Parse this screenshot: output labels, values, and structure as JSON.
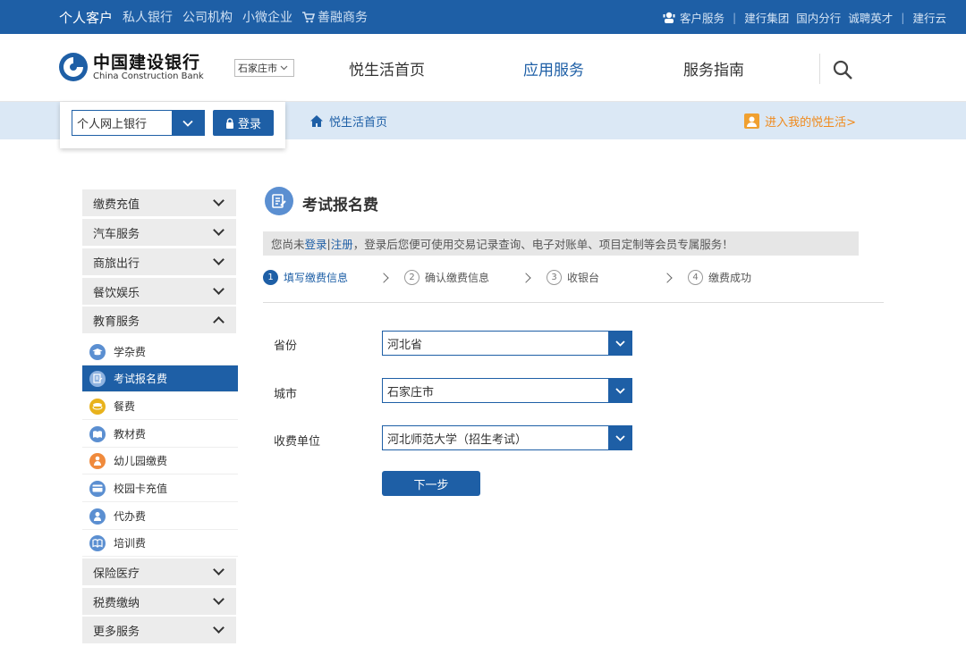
{
  "topbar": {
    "left": [
      {
        "label": "个人客户",
        "active": true
      },
      {
        "label": "私人银行"
      },
      {
        "label": "公司机构"
      },
      {
        "label": "小微企业"
      },
      {
        "label": "善融商务"
      }
    ],
    "customer_service": "客户服务",
    "ccb_group": "建行集团",
    "domestic_branches": "国内分行",
    "careers": "诚聘英才",
    "ccb_cloud": "建行云"
  },
  "header": {
    "logo_cn": "中国建设银行",
    "logo_en": "China Construction Bank",
    "city": "石家庄市",
    "nav": [
      "悦生活首页",
      "应用服务",
      "服务指南"
    ],
    "active_nav": "应用服务"
  },
  "login": {
    "channel": "个人网上银行",
    "button": "登录"
  },
  "breadcrumb": "悦生活首页",
  "mylife_link": "进入我的悦生活>",
  "sidebar": {
    "categories_top": [
      "缴费充值",
      "汽车服务",
      "商旅出行",
      "餐饮娱乐"
    ],
    "education": "教育服务",
    "education_items": [
      {
        "label": "学杂费",
        "icon": "graduation-cap-icon",
        "color": "#5b8fd1"
      },
      {
        "label": "考试报名费",
        "icon": "exam-form-icon",
        "color": "#5b8fd1",
        "active": true
      },
      {
        "label": "餐费",
        "icon": "meal-coin-icon",
        "color": "#e8b21c"
      },
      {
        "label": "教材费",
        "icon": "textbook-icon",
        "color": "#5b8fd1"
      },
      {
        "label": "幼儿园缴费",
        "icon": "kindergarten-icon",
        "color": "#f08a3c"
      },
      {
        "label": "校园卡充值",
        "icon": "campus-card-icon",
        "color": "#5b8fd1"
      },
      {
        "label": "代办费",
        "icon": "agent-fee-icon",
        "color": "#5b8fd1"
      },
      {
        "label": "培训费",
        "icon": "training-book-icon",
        "color": "#5b8fd1"
      }
    ],
    "categories_bottom": [
      "保险医疗",
      "税费缴纳",
      "更多服务"
    ]
  },
  "main": {
    "title": "考试报名费",
    "notice": {
      "prefix": "您尚未 ",
      "login": "登录",
      "sep": " | ",
      "register": "注册",
      "suffix": "，登录后您便可使用交易记录查询、电子对账单、项目定制等会员专属服务！"
    },
    "steps": [
      {
        "num": "1",
        "label": "填写缴费信息",
        "active": true
      },
      {
        "num": "2",
        "label": "确认缴费信息"
      },
      {
        "num": "3",
        "label": "收银台"
      },
      {
        "num": "4",
        "label": "缴费成功"
      }
    ],
    "form": {
      "province_label": "省份",
      "province_value": "河北省",
      "city_label": "城市",
      "city_value": "石家庄市",
      "payee_label": "收费单位",
      "payee_value": "河北师范大学（招生考试）",
      "next_button": "下一步"
    }
  },
  "colors": {
    "brand": "#1e5fa6",
    "subbar": "#dbe8f5",
    "orange": "#f08a1c"
  }
}
